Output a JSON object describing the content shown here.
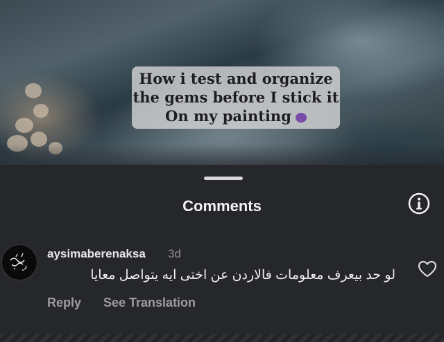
{
  "video": {
    "caption_lines": [
      "How i test and organize",
      "the gems before I stick it",
      "On my painting"
    ],
    "caption_emoji": "purple-face-emoji"
  },
  "comments_sheet": {
    "title": "Comments",
    "info_icon": "info-circle-icon",
    "comments": [
      {
        "avatar_icon": "calligraphy-avatar",
        "username": "aysimaberenaksa",
        "time": "3d",
        "text": "لو حد بيعرف معلومات فالاردن عن اختى ايه يتواصل معايا",
        "like_icon": "heart-outline-icon",
        "reply_label": "Reply",
        "translate_label": "See Translation"
      }
    ]
  },
  "colors": {
    "sheet_bg": "#26272b",
    "caption_bg": "#d2d2d2",
    "secondary_text": "#9b9ba0"
  }
}
